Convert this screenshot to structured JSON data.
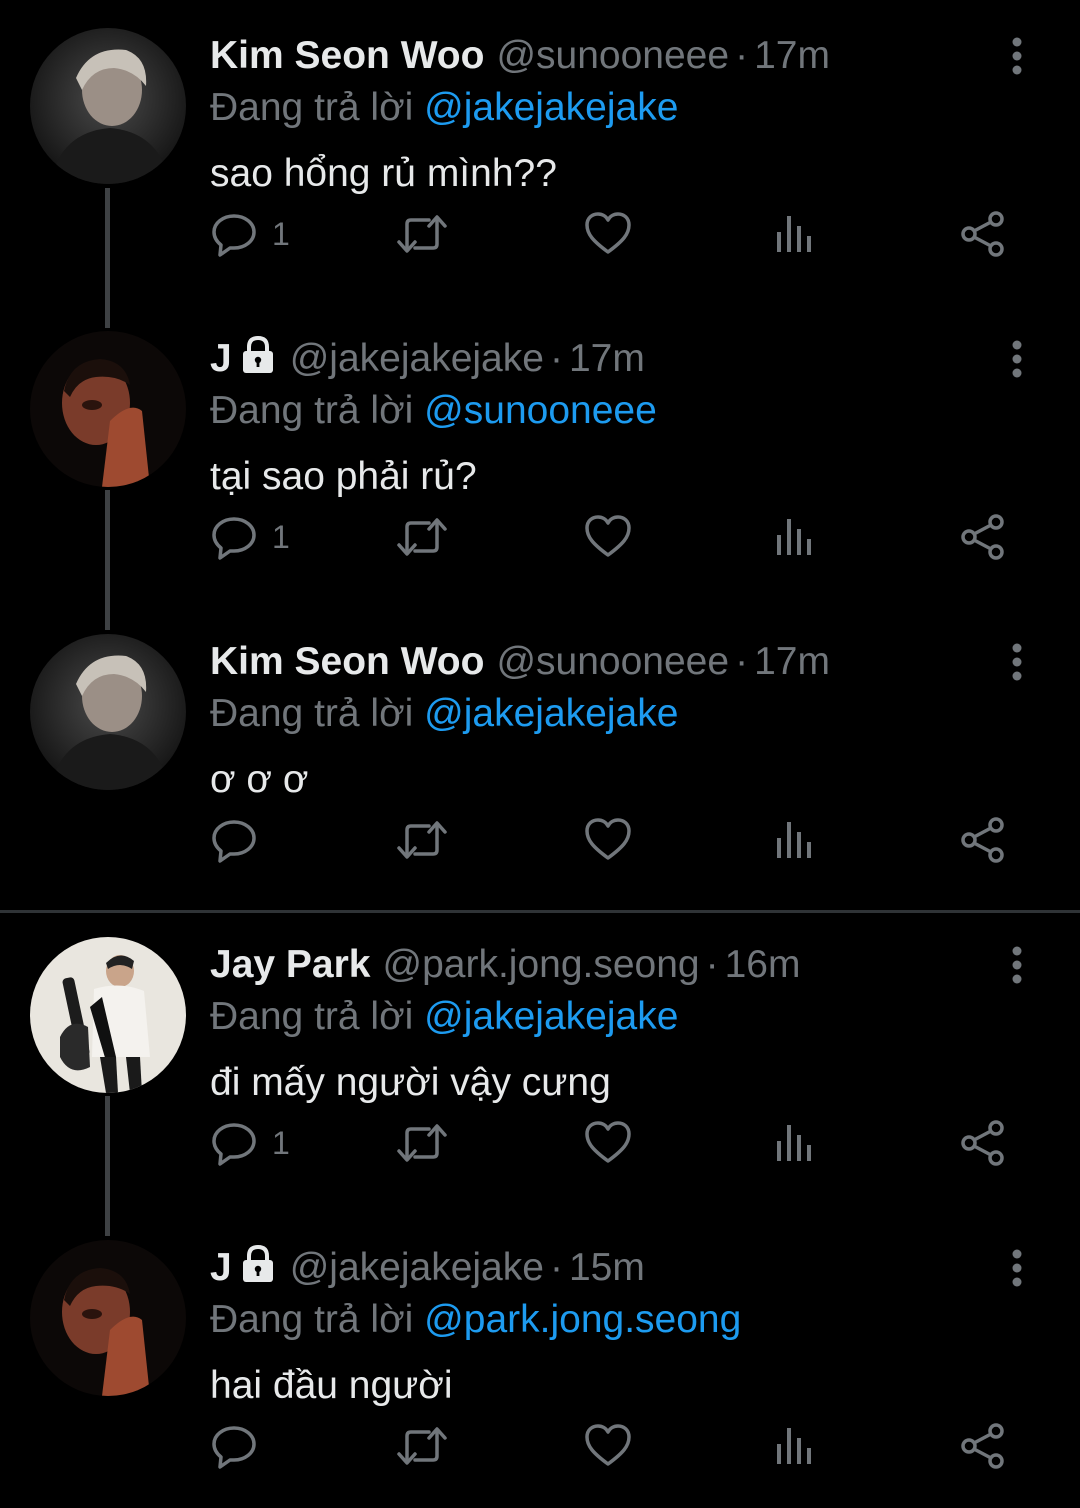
{
  "colors": {
    "background": "#000000",
    "text": "#e7e9ea",
    "secondary": "#71767b",
    "link": "#1d9bf0",
    "thread_line": "#3e4144"
  },
  "tweets": [
    {
      "name": "Kim Seon Woo",
      "handle": "@sunooneee",
      "dot": "·",
      "time": "17m",
      "locked": false,
      "reply_prefix": "Đang trả lời",
      "reply_to": "@jakejakejake",
      "text": "sao hổng rủ mình??",
      "reply_count": "1",
      "avatar_icon": "avatar-photo"
    },
    {
      "name": "J",
      "handle": "@jakejakejake",
      "dot": "·",
      "time": "17m",
      "locked": true,
      "reply_prefix": "Đang trả lời",
      "reply_to": "@sunooneee",
      "text": "tại sao phải rủ?",
      "reply_count": "1",
      "avatar_icon": "avatar-photo"
    },
    {
      "name": "Kim Seon Woo",
      "handle": "@sunooneee",
      "dot": "·",
      "time": "17m",
      "locked": false,
      "reply_prefix": "Đang trả lời",
      "reply_to": "@jakejakejake",
      "text": "ơ ơ ơ",
      "reply_count": "",
      "avatar_icon": "avatar-photo"
    },
    {
      "name": "Jay Park",
      "handle": "@park.jong.seong",
      "dot": "·",
      "time": "16m",
      "locked": false,
      "reply_prefix": "Đang trả lời",
      "reply_to": "@jakejakejake",
      "text": "đi mấy người vậy cưng",
      "reply_count": "1",
      "avatar_icon": "avatar-photo"
    },
    {
      "name": "J",
      "handle": "@jakejakejake",
      "dot": "·",
      "time": "15m",
      "locked": true,
      "reply_prefix": "Đang trả lời",
      "reply_to": "@park.jong.seong",
      "text": "hai đầu người",
      "reply_count": "",
      "avatar_icon": "avatar-photo"
    }
  ],
  "action_icons": [
    "reply-icon",
    "retweet-icon",
    "like-icon",
    "views-icon",
    "share-icon"
  ]
}
